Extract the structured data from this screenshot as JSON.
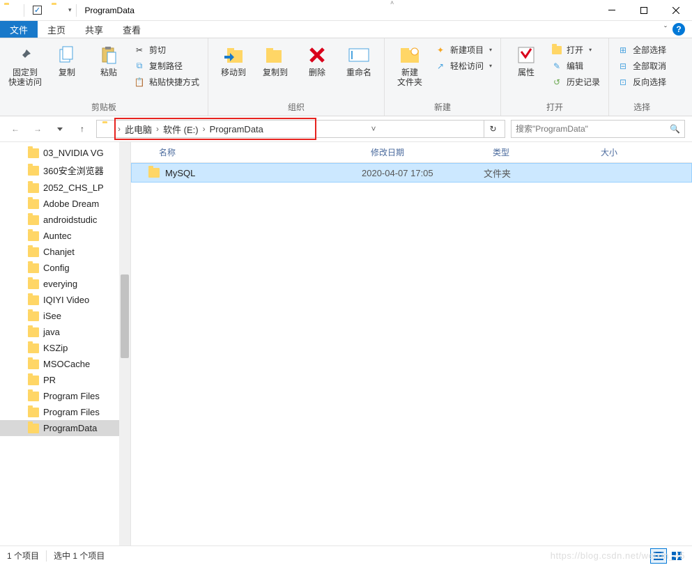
{
  "window": {
    "title": "ProgramData"
  },
  "tabs": {
    "file": "文件",
    "home": "主页",
    "share": "共享",
    "view": "查看"
  },
  "ribbon": {
    "clipboard": {
      "label": "剪贴板",
      "pin": "固定到\n快速访问",
      "copy": "复制",
      "paste": "粘贴",
      "cut": "剪切",
      "copy_path": "复制路径",
      "paste_shortcut": "粘贴快捷方式"
    },
    "organize": {
      "label": "组织",
      "move_to": "移动到",
      "copy_to": "复制到",
      "delete": "删除",
      "rename": "重命名"
    },
    "new": {
      "label": "新建",
      "new_folder": "新建\n文件夹",
      "new_item": "新建项目",
      "easy_access": "轻松访问"
    },
    "open": {
      "label": "打开",
      "properties": "属性",
      "open": "打开",
      "edit": "编辑",
      "history": "历史记录"
    },
    "select": {
      "label": "选择",
      "select_all": "全部选择",
      "select_none": "全部取消",
      "invert": "反向选择"
    }
  },
  "breadcrumb": {
    "seg1": "此电脑",
    "seg2": "软件 (E:)",
    "seg3": "ProgramData"
  },
  "search": {
    "placeholder": "搜索\"ProgramData\""
  },
  "columns": {
    "name": "名称",
    "date": "修改日期",
    "type": "类型",
    "size": "大小"
  },
  "files": [
    {
      "name": "MySQL",
      "date": "2020-04-07 17:05",
      "type": "文件夹",
      "size": ""
    }
  ],
  "tree": {
    "items": [
      "03_NVIDIA VG",
      "360安全浏览器",
      "2052_CHS_LP",
      "Adobe Dream",
      "androidstudic",
      "Auntec",
      "Chanjet",
      "Config",
      "everying",
      "IQIYI Video",
      "iSee",
      "java",
      "KSZip",
      "MSOCache",
      "PR",
      "Program Files",
      "Program Files",
      "ProgramData"
    ],
    "selected_index": 17
  },
  "status": {
    "items": "1 个项目",
    "selected": "选中 1 个项目"
  },
  "watermark": "https://blog.csdn.net/weixin_45"
}
